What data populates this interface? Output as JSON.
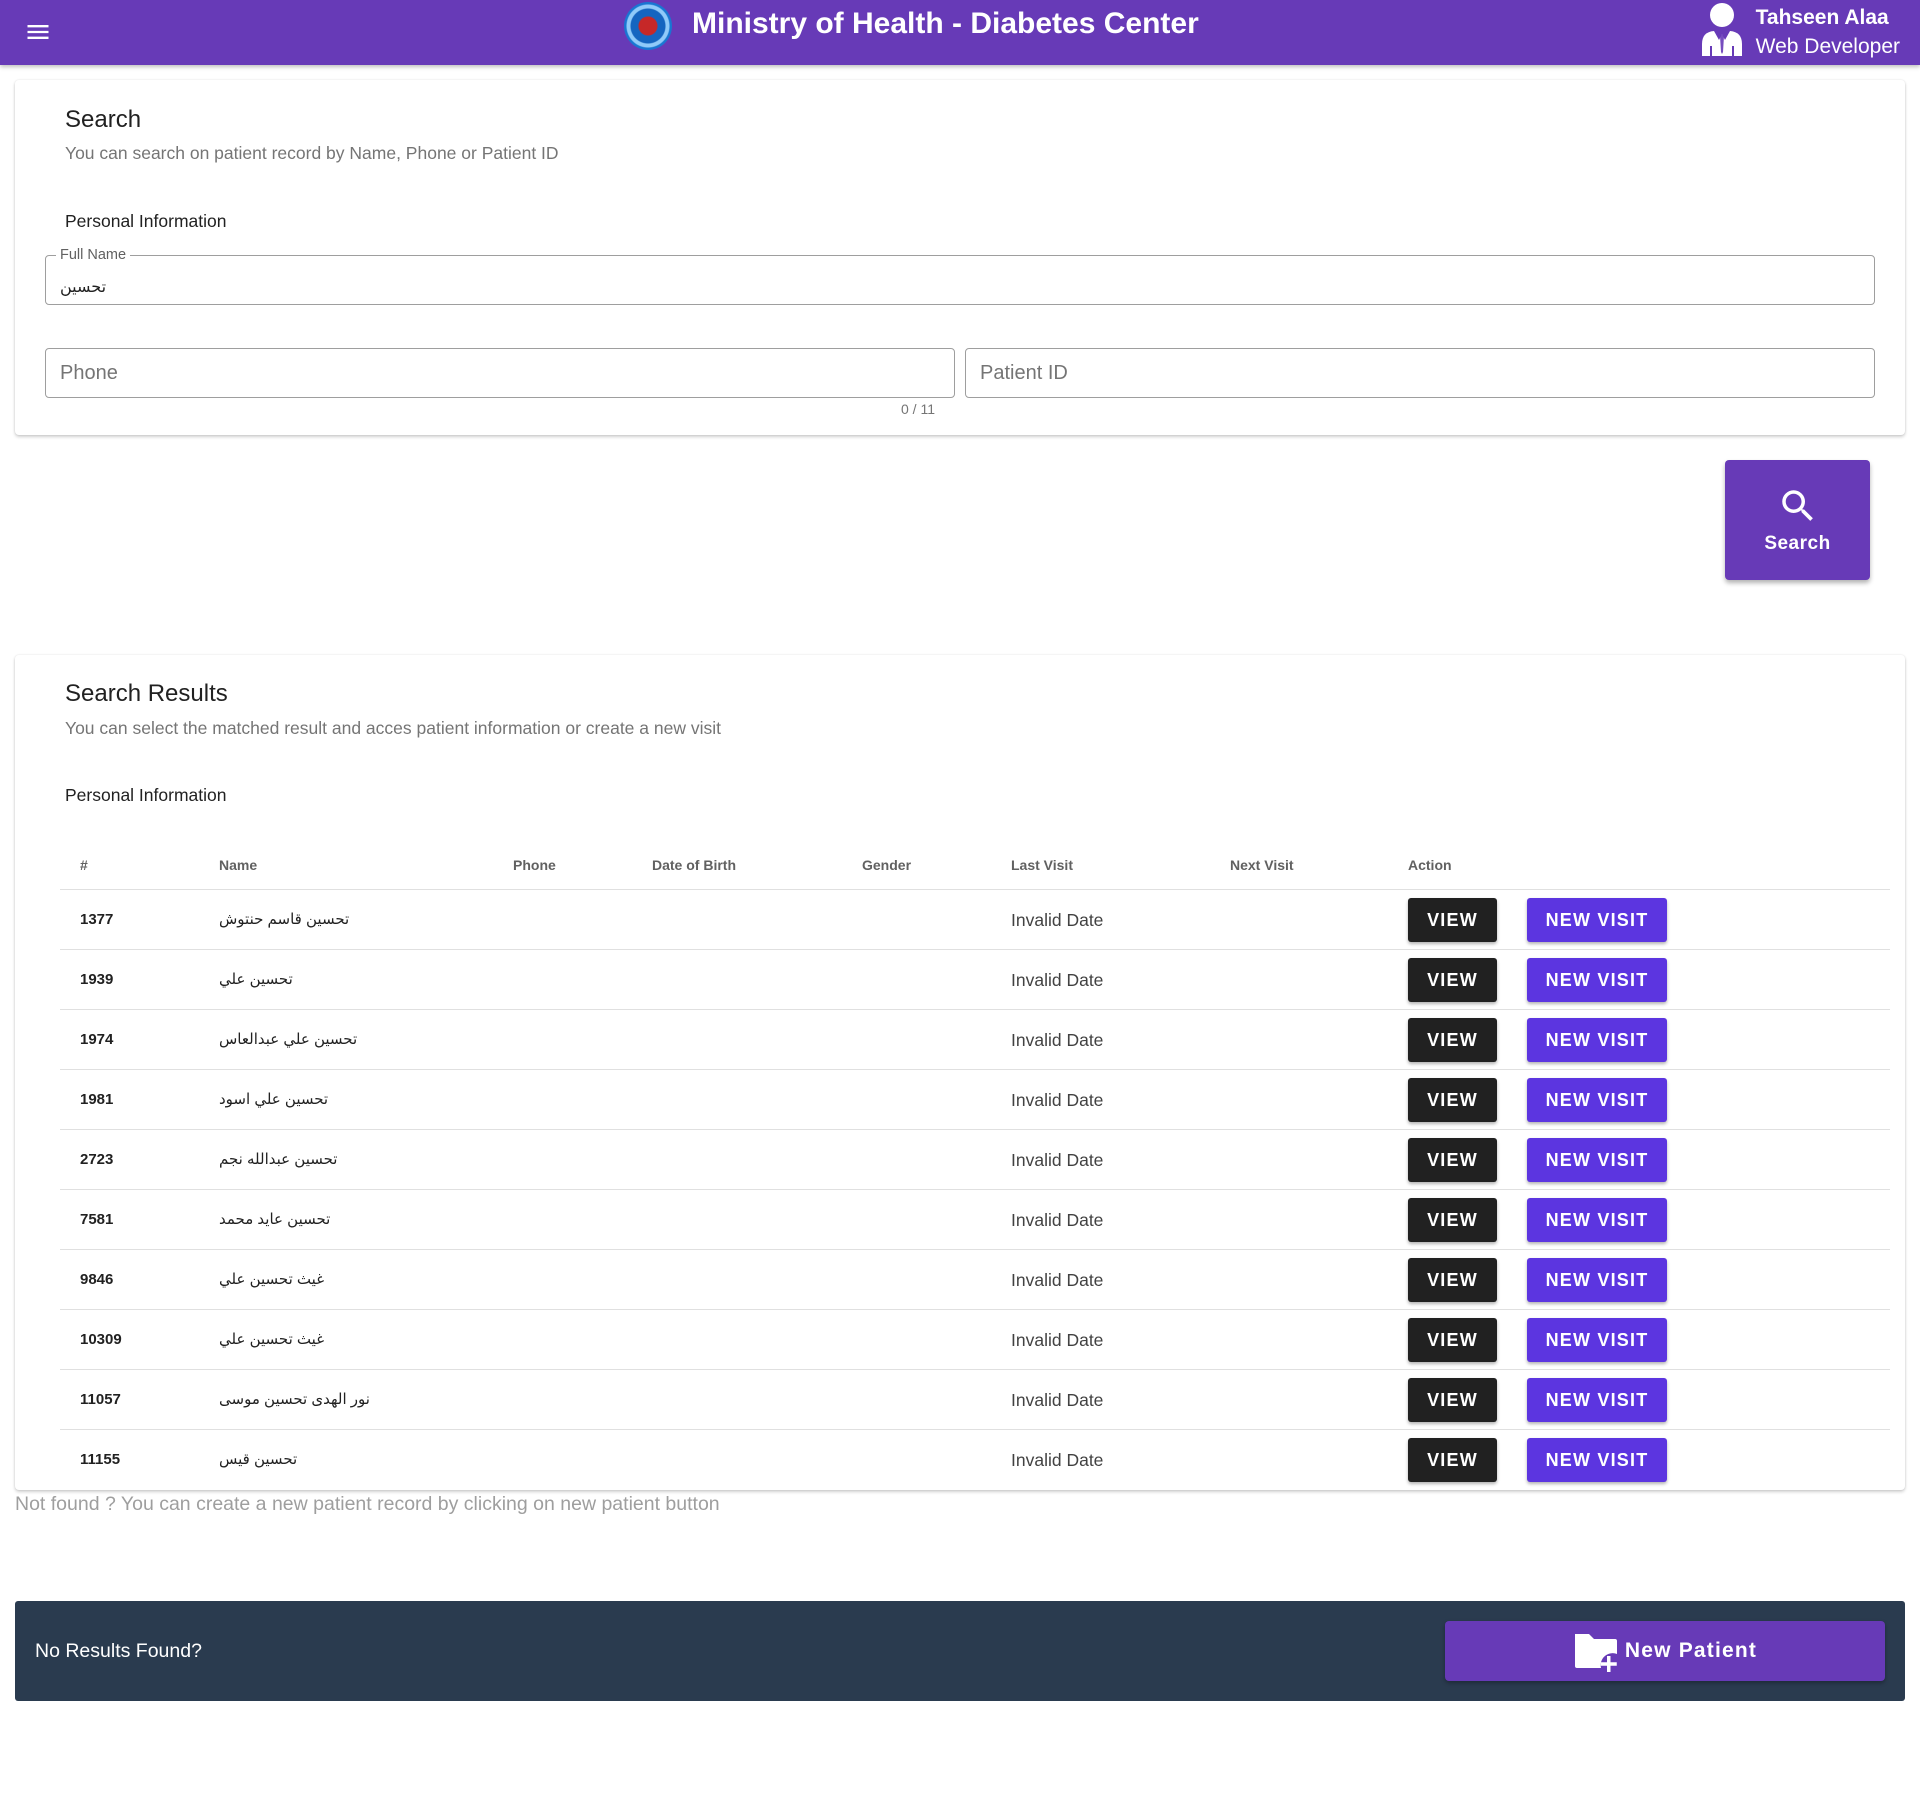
{
  "appbar": {
    "title": "Ministry of Health - Diabetes Center",
    "user_name": "Tahseen Alaa",
    "user_role": "Web Developer"
  },
  "search_card": {
    "title": "Search",
    "subtitle": "You can search on patient record by Name, Phone or Patient ID",
    "section_label": "Personal Information",
    "full_name_label": "Full Name",
    "full_name_value": "تحسين",
    "phone_placeholder": "Phone",
    "phone_counter": "0 / 11",
    "patient_id_placeholder": "Patient ID"
  },
  "search_button": {
    "label": "Search"
  },
  "results_card": {
    "title": "Search Results",
    "subtitle": "You can select the matched result and acces patient information or create a new visit",
    "section_label": "Personal Information",
    "columns": [
      "#",
      "Name",
      "Phone",
      "Date of Birth",
      "Gender",
      "Last Visit",
      "Next Visit",
      "Action"
    ],
    "rows": [
      {
        "id": "1377",
        "name": "تحسين قاسم حنتوش",
        "last_visit": "Invalid Date"
      },
      {
        "id": "1939",
        "name": "تحسين علي",
        "last_visit": "Invalid Date"
      },
      {
        "id": "1974",
        "name": "تحسين علي عبدالعاس",
        "last_visit": "Invalid Date"
      },
      {
        "id": "1981",
        "name": "تحسين علي اسود",
        "last_visit": "Invalid Date"
      },
      {
        "id": "2723",
        "name": "تحسين عبدالله نجم",
        "last_visit": "Invalid Date"
      },
      {
        "id": "7581",
        "name": "تحسين عايد محمد",
        "last_visit": "Invalid Date"
      },
      {
        "id": "9846",
        "name": "غيث تحسين علي",
        "last_visit": "Invalid Date"
      },
      {
        "id": "10309",
        "name": "غيث تحسين علي",
        "last_visit": "Invalid Date"
      },
      {
        "id": "11057",
        "name": "نور الهدى تحسين موسى",
        "last_visit": "Invalid Date"
      },
      {
        "id": "11155",
        "name": "تحسين قيس",
        "last_visit": "Invalid Date"
      }
    ],
    "view_label": "VIEW",
    "new_visit_label": "NEW VISIT"
  },
  "not_found_text": "Not found ? You can create a new patient record by clicking on new patient button",
  "footer": {
    "text": "No Results Found?",
    "new_patient_label": "New Patient"
  },
  "icons": {
    "menu": "menu-icon",
    "logo": "ministry-logo",
    "user": "user-tie-icon",
    "search": "magnify-icon",
    "new_patient": "folder-plus-icon"
  },
  "colors": {
    "primary": "#673ab7",
    "new_visit": "#5c35e0",
    "view": "#212121",
    "footer": "#2a3b4f"
  }
}
